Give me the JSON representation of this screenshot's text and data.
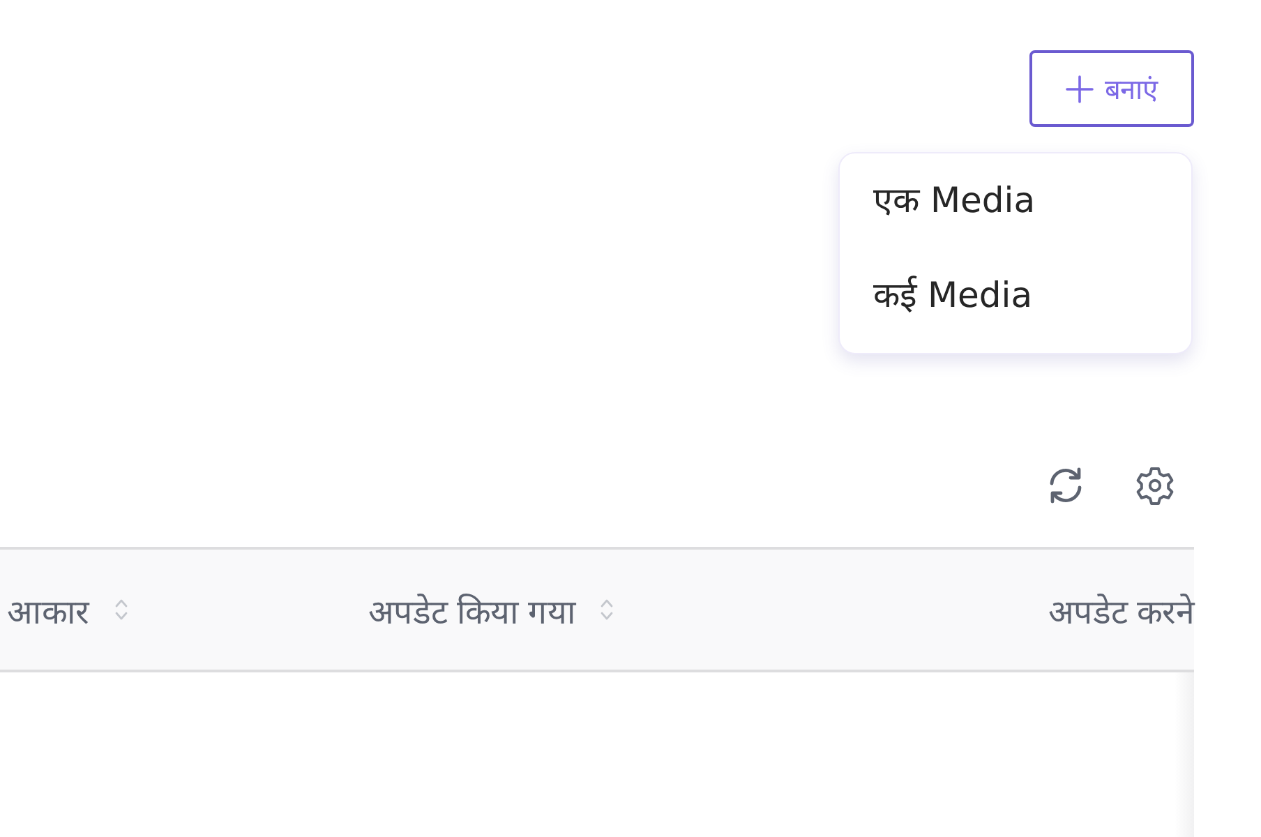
{
  "create_button": {
    "label": "बनाएं"
  },
  "create_menu": {
    "items": [
      {
        "label": "एक Media"
      },
      {
        "label": "कई Media"
      }
    ]
  },
  "table": {
    "columns": [
      {
        "label": "आकार",
        "sortable": true
      },
      {
        "label": "अपडेट किया गया",
        "sortable": true
      },
      {
        "label": "अपडेट करने",
        "sortable": false
      }
    ]
  }
}
